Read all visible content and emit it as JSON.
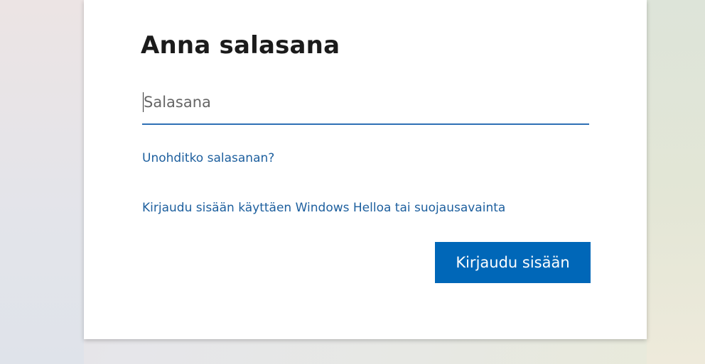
{
  "page": {
    "title": "Anna salasana"
  },
  "password_field": {
    "placeholder": "Salasana",
    "value": ""
  },
  "links": {
    "forgot_password": "Unohditko salasanan?",
    "windows_hello": "Kirjaudu sisään käyttäen Windows Helloa tai suojausavainta"
  },
  "actions": {
    "sign_in_label": "Kirjaudu sisään"
  },
  "colors": {
    "accent": "#0067b8",
    "link": "#1d5f9e",
    "input_underline": "#2e6fb5",
    "title_text": "#1b1b1b"
  }
}
